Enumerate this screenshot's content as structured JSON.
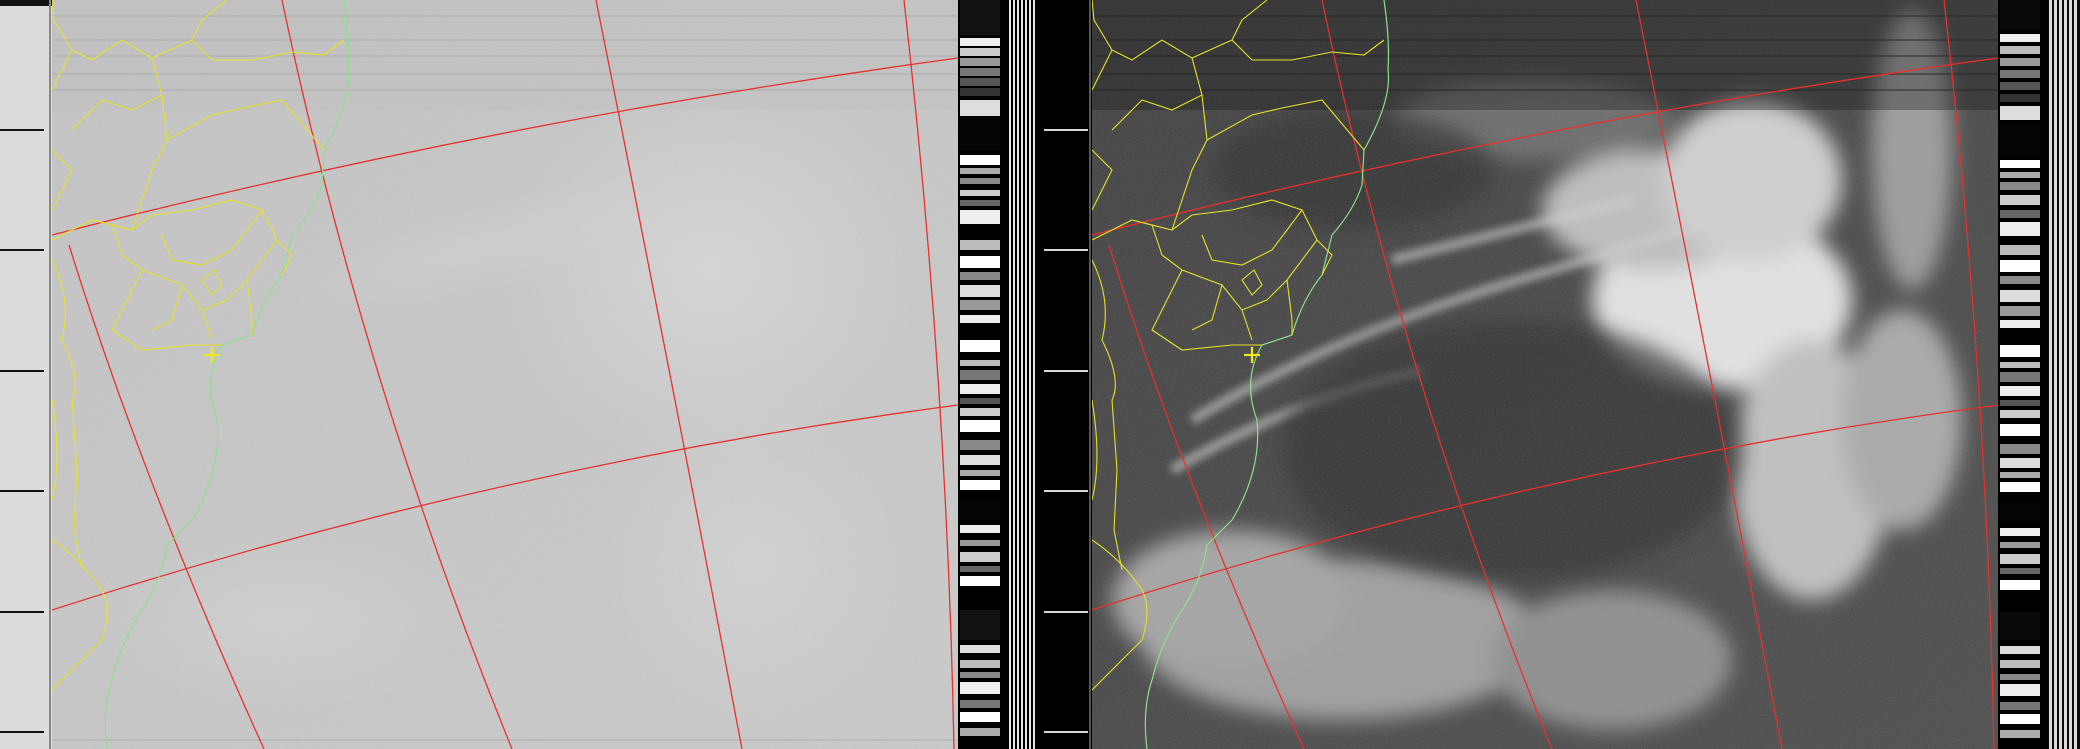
{
  "image": {
    "kind": "APT weather satellite image",
    "channels": [
      {
        "id": "a",
        "tone": "visible-bright",
        "grid_color": "#e8302c",
        "coast_color": "#8de08d",
        "border_color": "#e6e227",
        "marker_color": "#f2e81e"
      },
      {
        "id": "b",
        "tone": "infrared-dark",
        "grid_color": "#e8302c",
        "coast_color": "#8de08d",
        "border_color": "#e6e227",
        "marker_color": "#f2e81e"
      }
    ],
    "colors": {
      "grid": "#e8302c",
      "coastline": "#8de08d",
      "borders": "#e6e227",
      "marker": "#f2e81e",
      "background": "#000000"
    }
  }
}
